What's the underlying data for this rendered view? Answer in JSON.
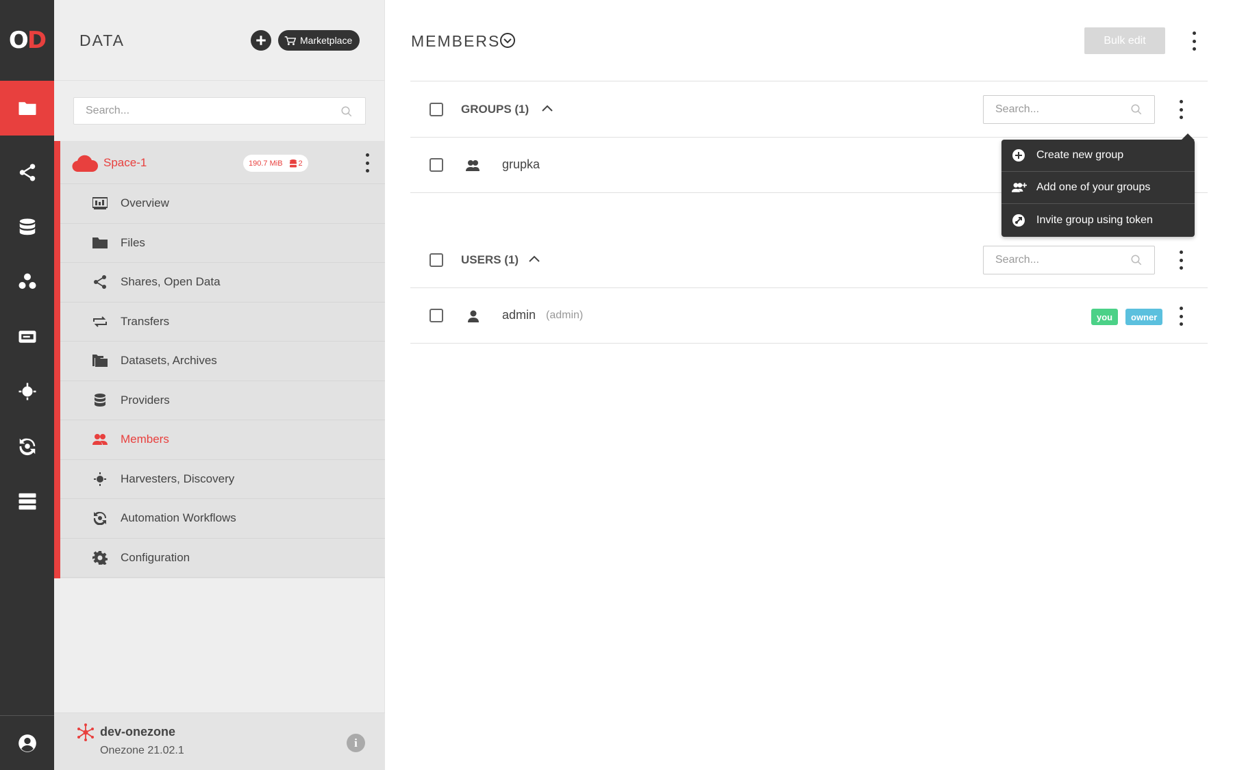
{
  "app": {
    "logo_text": "O",
    "logo_accent": "D",
    "accent_color": "#e8403e"
  },
  "rail": {
    "items": [
      {
        "icon": "folder-icon",
        "active": true
      },
      {
        "icon": "share-icon",
        "active": false
      },
      {
        "icon": "database-icon",
        "active": false
      },
      {
        "icon": "groups-icon",
        "active": false
      },
      {
        "icon": "tokens-icon",
        "active": false
      },
      {
        "icon": "harvester-icon",
        "active": false
      },
      {
        "icon": "workflow-icon",
        "active": false
      },
      {
        "icon": "clusters-icon",
        "active": false
      }
    ],
    "bottom_icon": "user-icon"
  },
  "sidebar": {
    "title": "DATA",
    "marketplace_label": "Marketplace",
    "search_placeholder": "Search...",
    "space": {
      "name": "Space-1",
      "size": "190.7 MiB",
      "providers_count": "2"
    },
    "menu": [
      {
        "label": "Overview",
        "icon": "overview-icon"
      },
      {
        "label": "Files",
        "icon": "folder-icon"
      },
      {
        "label": "Shares, Open Data",
        "icon": "share-icon"
      },
      {
        "label": "Transfers",
        "icon": "transfers-icon"
      },
      {
        "label": "Datasets, Archives",
        "icon": "datasets-icon"
      },
      {
        "label": "Providers",
        "icon": "providers-icon"
      },
      {
        "label": "Members",
        "icon": "members-icon",
        "active": true
      },
      {
        "label": "Harvesters, Discovery",
        "icon": "harvester-icon"
      },
      {
        "label": "Automation Workflows",
        "icon": "workflow-icon"
      },
      {
        "label": "Configuration",
        "icon": "gear-icon"
      }
    ],
    "footer": {
      "zone_name": "dev-onezone",
      "zone_version": "Onezone 21.02.1",
      "info_label": "i"
    }
  },
  "main": {
    "title": "MEMBERS",
    "bulk_edit_label": "Bulk edit",
    "groups": {
      "title": "GROUPS (1)",
      "search_placeholder": "Search...",
      "rows": [
        {
          "name": "grupka"
        }
      ]
    },
    "users": {
      "title": "USERS (1)",
      "search_placeholder": "Search...",
      "rows": [
        {
          "name": "admin",
          "sub": "(admin)",
          "tags": [
            "you",
            "owner"
          ]
        }
      ]
    },
    "dropdown": {
      "items": [
        {
          "label": "Create new group",
          "icon": "plus-circle-icon"
        },
        {
          "label": "Add one of your groups",
          "icon": "add-group-icon"
        },
        {
          "label": "Invite group using token",
          "icon": "token-icon"
        }
      ]
    }
  }
}
